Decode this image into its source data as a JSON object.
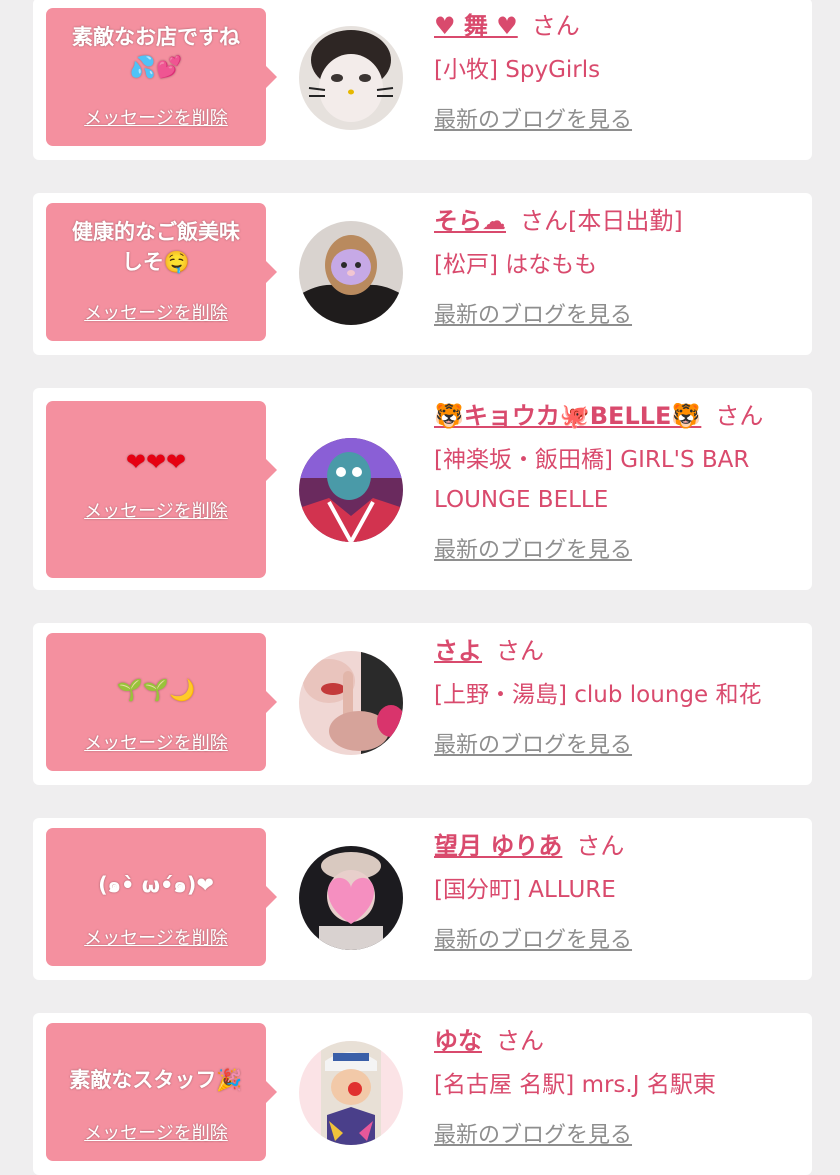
{
  "delete_label": "メッセージを削除",
  "san_label": "さん",
  "blog_label": "最新のブログを見る",
  "colors": {
    "background": "#efeeef",
    "card": "#ffffff",
    "bubble": "#f4909f",
    "accent_text": "#d94a6d",
    "link_gray": "#8e8e8e"
  },
  "items": [
    {
      "message": "素敵なお店ですね\n💦💕",
      "name": "♥ 舞 ♥",
      "status": "",
      "shop": "[小牧] SpyGirls",
      "avatar": "white-cat-mask-photo"
    },
    {
      "message": "健康的なご飯美味しそ🤤",
      "name": "そら☁",
      "status": "[本日出勤]",
      "shop": "[松戸] はなもも",
      "avatar": "ghost-sticker-photo"
    },
    {
      "message": "❤❤❤",
      "name": "🐯キョウカ🐙BELLE🐯",
      "status": "",
      "shop": "[神楽坂・飯田橋] GIRL'S BAR LOUNGE BELLE",
      "avatar": "blue-creature-photo"
    },
    {
      "message": "🌱🌱🌙",
      "name": "さよ",
      "status": "",
      "shop": "[上野・湯島] club lounge 和花",
      "avatar": "hand-pose-photo"
    },
    {
      "message": "(๑•̀ ω•́๑)❤",
      "name": "望月 ゆりあ",
      "status": "",
      "shop": "[国分町] ALLURE",
      "avatar": "heart-face-photo"
    },
    {
      "message": "素敵なスタッフ🎉",
      "name": "ゆな",
      "status": "",
      "shop": "[名古屋 名駅] mrs.J 名駅東",
      "avatar": "cap-selfie-photo"
    }
  ]
}
